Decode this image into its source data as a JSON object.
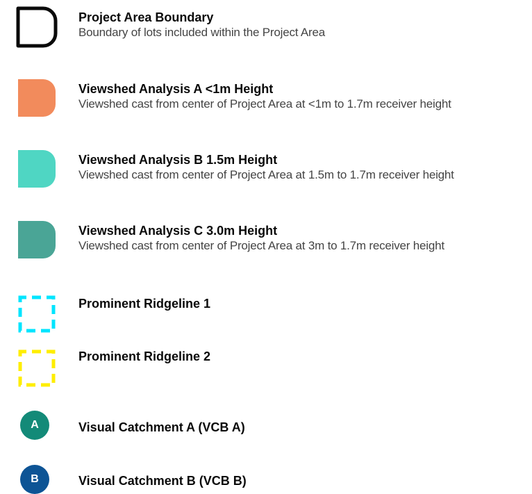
{
  "colors": {
    "boundary_stroke": "#0a0a0a",
    "viewshed_a": "#f28b5c",
    "viewshed_b": "#4fd6c3",
    "viewshed_c": "#4aa596",
    "ridgeline_1": "#00e5ff",
    "ridgeline_2": "#ffee00",
    "vcb_a": "#138a78",
    "vcb_b": "#0d5495"
  },
  "legend": {
    "project_area": {
      "title": "Project Area Boundary",
      "description": "Boundary of lots included within the Project Area",
      "icon": "rounded-square-outline-icon"
    },
    "viewshed_a": {
      "title": "Viewshed Analysis A <1m Height",
      "description": "Viewshed cast from center of Project Area at <1m  to 1.7m receiver height",
      "icon": "orange-swatch-icon"
    },
    "viewshed_b": {
      "title": "Viewshed Analysis B 1.5m Height",
      "description": "Viewshed cast from center of Project Area at 1.5m to 1.7m receiver height",
      "icon": "turquoise-swatch-icon"
    },
    "viewshed_c": {
      "title": "Viewshed Analysis C 3.0m Height",
      "description": "Viewshed cast from center of Project Area at 3m to 1.7m receiver height",
      "icon": "teal-swatch-icon"
    },
    "ridgeline_1": {
      "title": "Prominent Ridgeline 1",
      "icon": "cyan-dashed-square-icon"
    },
    "ridgeline_2": {
      "title": "Prominent Ridgeline 2",
      "icon": "yellow-dashed-square-icon"
    },
    "vcb_a": {
      "title": "Visual Catchment A (VCB A)",
      "badge": "A",
      "icon": "vcb-a-badge-icon"
    },
    "vcb_b": {
      "title": "Visual Catchment B (VCB B)",
      "badge": "B",
      "icon": "vcb-b-badge-icon"
    }
  }
}
